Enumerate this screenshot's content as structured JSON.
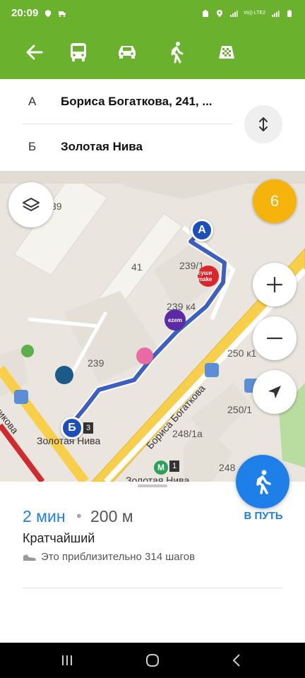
{
  "status_bar": {
    "time": "20:09",
    "network_label": "Vo)) LTE2"
  },
  "transport_modes": [
    {
      "icon": "bus-icon"
    },
    {
      "icon": "car-icon"
    },
    {
      "icon": "walk-icon"
    },
    {
      "icon": "taxi-icon"
    }
  ],
  "route": {
    "point_a_letter": "А",
    "point_a_address": "Бориса Богаткова, 241, ...",
    "point_b_letter": "Б",
    "point_b_address": "Золотая Нива"
  },
  "map": {
    "layers_badge_count": "6",
    "labels": {
      "b39": "39",
      "b41": "41",
      "b239_1": "239/1",
      "b239_k4": "239 к4",
      "b239": "239",
      "b250": "250 к1",
      "b250_1": "250/1",
      "b248_1a": "248/1а",
      "b248": "248",
      "street_bogatkova": "Бориса Богаткова",
      "street_left": "никова",
      "stop_zolotaya_niva": "Золотая Нива",
      "metro_zolotaya_niva": "Золотая Нива",
      "pin_a": "А",
      "pin_b": "Б",
      "tag_3": "3",
      "metro_line": "1",
      "poi_sushi": "суши make",
      "poi_ozon": "ezem"
    }
  },
  "summary": {
    "time": "2 мин",
    "separator": "•",
    "distance": "200 м",
    "route_type": "Кратчайший",
    "steps_text": "Это приблизительно 314 шагов",
    "go_button": "В ПУТЬ"
  },
  "colors": {
    "accent_green": "#6ab22e",
    "route_blue": "#1c4fb7",
    "go_blue": "#1e7fe8",
    "badge_yellow": "#f5b30c"
  }
}
